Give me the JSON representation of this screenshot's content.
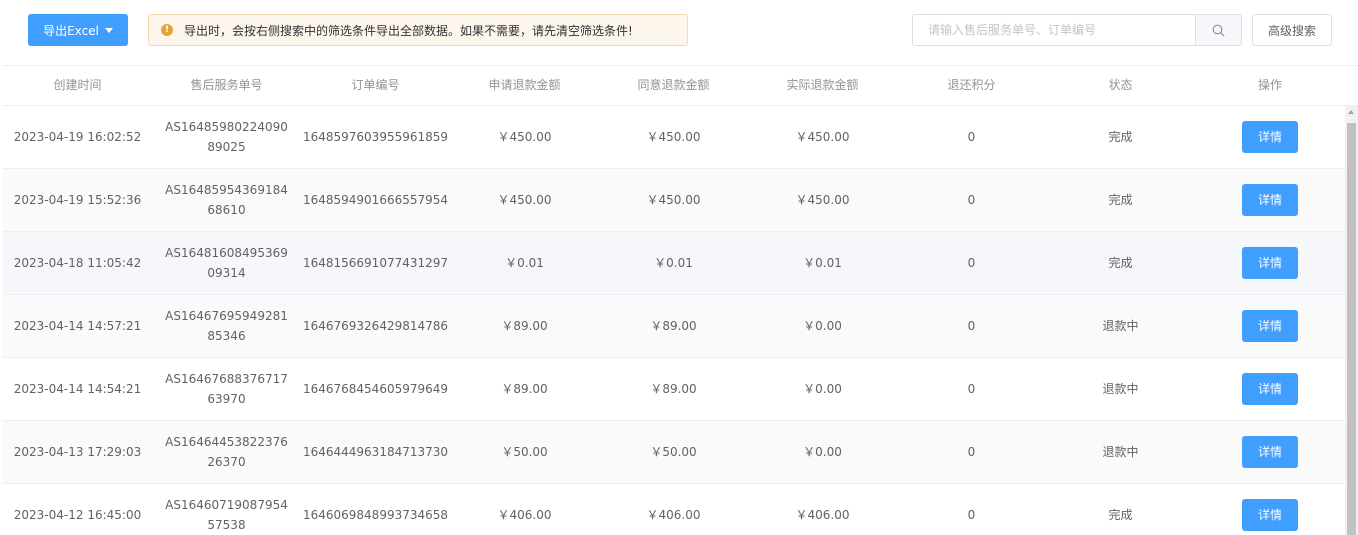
{
  "toolbar": {
    "export_label": "导出Excel",
    "alert_text": "导出时，会按右侧搜索中的筛选条件导出全部数据。如果不需要，请先清空筛选条件!",
    "search_placeholder": "请输入售后服务单号、订单编号",
    "search_value": "",
    "advanced_label": "高级搜索"
  },
  "table": {
    "columns": [
      "创建时间",
      "售后服务单号",
      "订单编号",
      "申请退款金额",
      "同意退款金额",
      "实际退款金额",
      "退还积分",
      "状态",
      "操作"
    ],
    "rows": [
      {
        "created": "2023-04-19 16:02:52",
        "service_no": "AS1648598022409089025",
        "order_no": "1648597603955961859",
        "applied": "￥450.00",
        "agreed": "￥450.00",
        "actual": "￥450.00",
        "points": "0",
        "status": "完成",
        "action": "详情"
      },
      {
        "created": "2023-04-19 15:52:36",
        "service_no": "AS1648595436918468610",
        "order_no": "1648594901666557954",
        "applied": "￥450.00",
        "agreed": "￥450.00",
        "actual": "￥450.00",
        "points": "0",
        "status": "完成",
        "action": "详情"
      },
      {
        "created": "2023-04-18 11:05:42",
        "service_no": "AS1648160849536909314",
        "order_no": "1648156691077431297",
        "applied": "￥0.01",
        "agreed": "￥0.01",
        "actual": "￥0.01",
        "points": "0",
        "status": "完成",
        "action": "详情"
      },
      {
        "created": "2023-04-14 14:57:21",
        "service_no": "AS1646769594928185346",
        "order_no": "1646769326429814786",
        "applied": "￥89.00",
        "agreed": "￥89.00",
        "actual": "￥0.00",
        "points": "0",
        "status": "退款中",
        "action": "详情"
      },
      {
        "created": "2023-04-14 14:54:21",
        "service_no": "AS1646768837671763970",
        "order_no": "1646768454605979649",
        "applied": "￥89.00",
        "agreed": "￥89.00",
        "actual": "￥0.00",
        "points": "0",
        "status": "退款中",
        "action": "详情"
      },
      {
        "created": "2023-04-13 17:29:03",
        "service_no": "AS1646445382237626370",
        "order_no": "1646444963184713730",
        "applied": "￥50.00",
        "agreed": "￥50.00",
        "actual": "￥0.00",
        "points": "0",
        "status": "退款中",
        "action": "详情"
      },
      {
        "created": "2023-04-12 16:45:00",
        "service_no": "AS1646071908795457538",
        "order_no": "1646069848993734658",
        "applied": "￥406.00",
        "agreed": "￥406.00",
        "actual": "￥406.00",
        "points": "0",
        "status": "完成",
        "action": "详情"
      }
    ]
  },
  "colors": {
    "primary": "#409eff",
    "warning": "#e6a23c",
    "alert_bg": "#fdf6ec"
  },
  "icons": {
    "export_caret": "caret-down-icon",
    "alert": "warning-icon",
    "search": "search-icon"
  }
}
